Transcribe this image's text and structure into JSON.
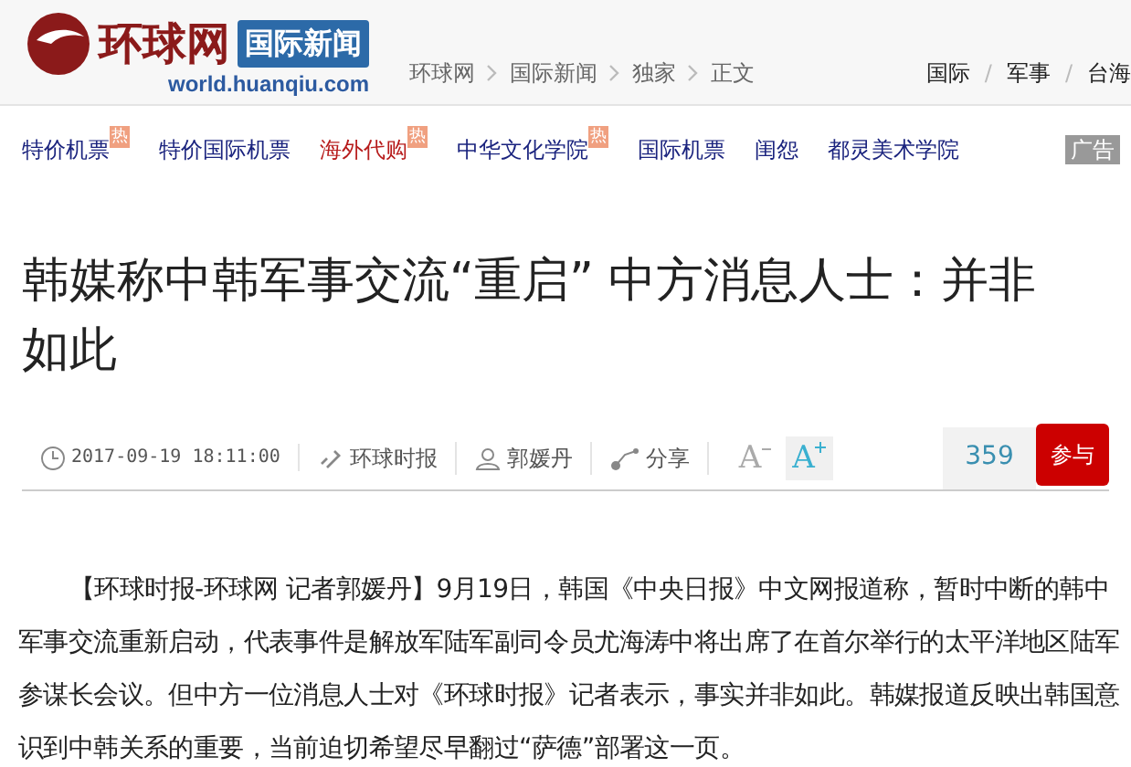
{
  "header": {
    "logo_text": "环球网",
    "section_badge": "国际新闻",
    "domain": "world.huanqiu.com",
    "breadcrumb": [
      "环球网",
      "国际新闻",
      "独家",
      "正文"
    ],
    "channels": [
      "国际",
      "军事",
      "台海"
    ],
    "channel_separator": "/"
  },
  "ad_links": [
    {
      "label": "特价机票",
      "hot": true,
      "badge": "热",
      "kind": "normal"
    },
    {
      "label": "特价国际机票",
      "hot": false,
      "kind": "normal"
    },
    {
      "label": "海外代购",
      "hot": true,
      "badge": "热",
      "kind": "highlight"
    },
    {
      "label": "中华文化学院",
      "hot": true,
      "badge": "热",
      "kind": "normal"
    },
    {
      "label": "国际机票",
      "hot": false,
      "kind": "normal"
    },
    {
      "label": "闺怨",
      "hot": false,
      "kind": "normal"
    },
    {
      "label": "都灵美术学院",
      "hot": false,
      "kind": "normal"
    }
  ],
  "ad_tag": "广告",
  "article": {
    "title": "韩媒称中韩军事交流“重启” 中方消息人士：并非如此",
    "meta": {
      "datetime": "2017-09-19 18:11:00",
      "source": "环球时报",
      "author": "郭媛丹",
      "share": "分享",
      "font_smaller": "A",
      "font_larger": "A",
      "font_larger_selected": true,
      "comment_count": "359",
      "join": "参与"
    },
    "paragraphs": [
      "【环球时报-环球网 记者郭媛丹】9月19日，韩国《中央日报》中文网报道称，暂时中断的韩中军事交流重新启动，代表事件是解放军陆军副司令员尤海涛中将出席了在首尔举行的太平洋地区陆军参谋长会议。但中方一位消息人士对《环球时报》记者表示，事实并非如此。韩媒报道反映出韩国意识到中韩关系的重要，当前迫切希望尽早翻过“萨德”部署这一页。"
    ]
  }
}
